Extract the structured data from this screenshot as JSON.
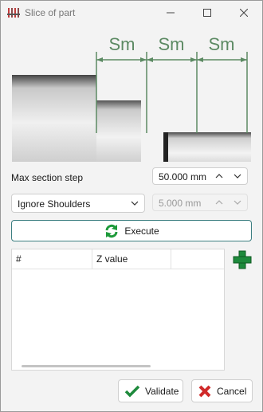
{
  "window": {
    "title": "Slice of part"
  },
  "illustration": {
    "dimension_labels": [
      "Sm",
      "Sm",
      "Sm"
    ],
    "accent_color": "#5c8a63"
  },
  "max_step": {
    "label": "Max section step",
    "value": "50.000 mm"
  },
  "shoulders": {
    "selected": "Ignore Shoulders",
    "value": "5.000 mm"
  },
  "execute": {
    "label": "Execute"
  },
  "table": {
    "columns": [
      "#",
      "Z value",
      ""
    ]
  },
  "buttons": {
    "validate": "Validate",
    "cancel": "Cancel"
  },
  "colors": {
    "green": "#1e8a3c",
    "red": "#d02a2a"
  }
}
